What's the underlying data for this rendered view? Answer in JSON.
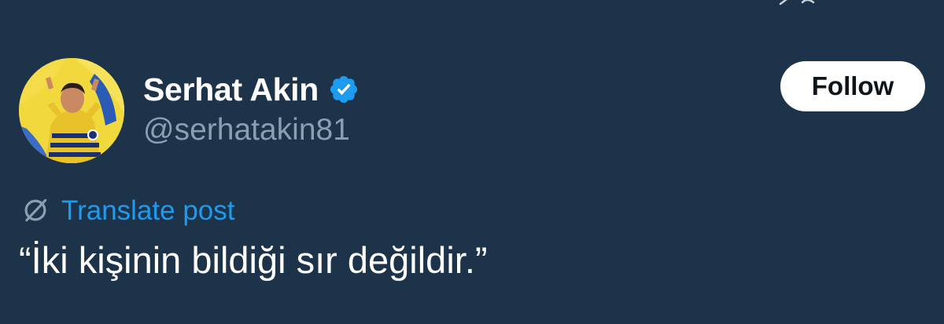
{
  "user": {
    "display_name": "Serhat Akin",
    "handle": "@serhatakin81",
    "verified": true
  },
  "actions": {
    "follow_label": "Follow",
    "translate_label": "Translate post"
  },
  "post": {
    "text": "“İki kişinin bildiği sır değildir.”"
  },
  "colors": {
    "background": "#1d3349",
    "accent": "#1d9bf0",
    "handle": "#8c9fb2",
    "follow_bg": "#ffffff"
  },
  "icons": {
    "verified": "verified-badge-icon",
    "translate": "globe-translate-icon"
  }
}
